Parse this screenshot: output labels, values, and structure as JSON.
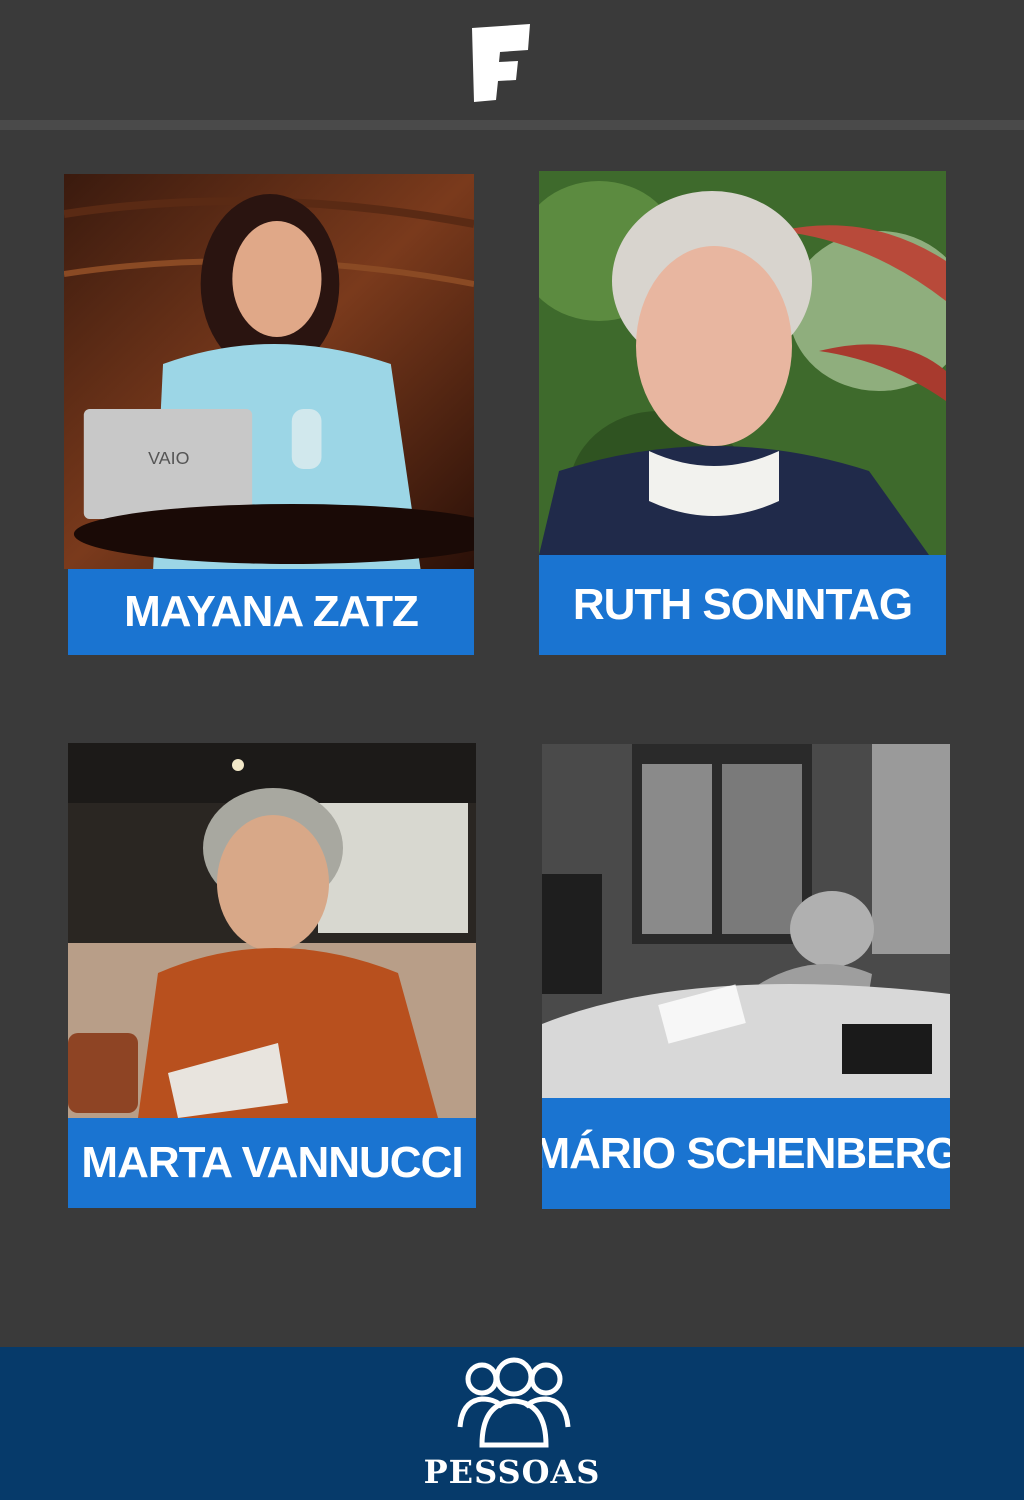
{
  "header": {
    "logo_icon": "f-logo-icon"
  },
  "people": [
    {
      "name": "MAYANA ZATZ"
    },
    {
      "name": "RUTH SONNTAG"
    },
    {
      "name": "MARTA VANNUCCI"
    },
    {
      "name": "MÁRIO SCHENBERG"
    }
  ],
  "bottom_nav": {
    "label": "PESSOAS",
    "icon": "people-icon"
  },
  "colors": {
    "background": "#3a3a3a",
    "label_blue": "#1a74d1",
    "nav_blue": "#063a6a"
  }
}
